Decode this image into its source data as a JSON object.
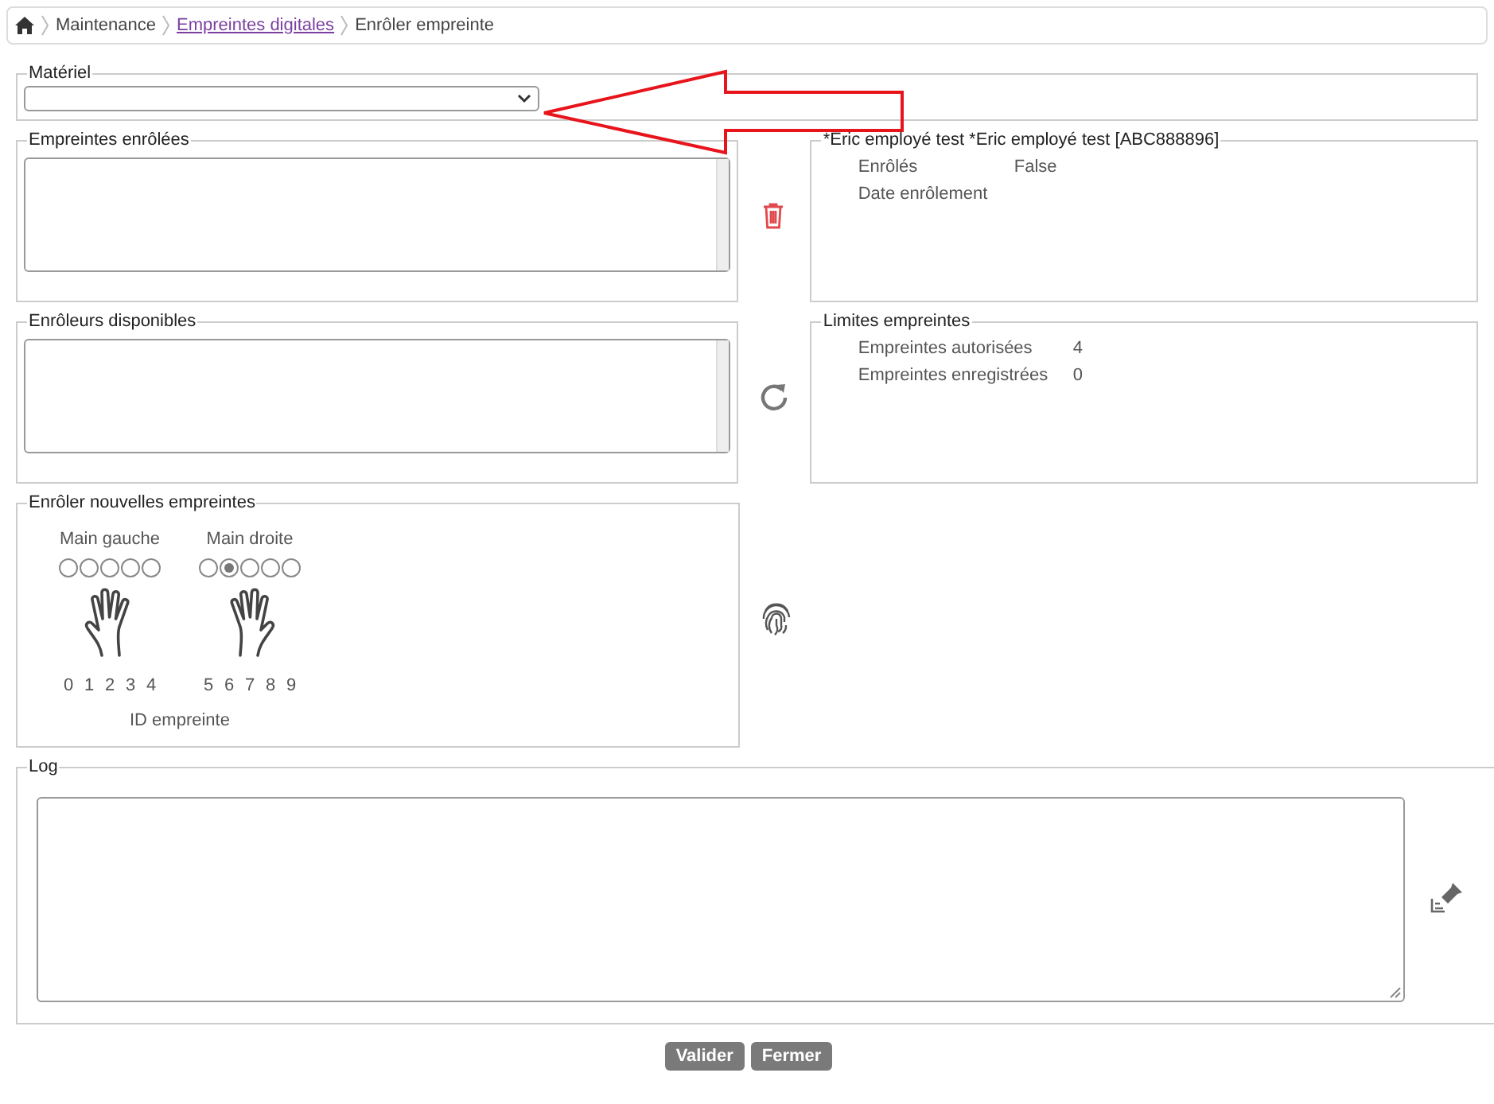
{
  "breadcrumb": [
    {
      "label": "Maintenance",
      "kind": "plain"
    },
    {
      "label": "Empreintes digitales",
      "kind": "link"
    },
    {
      "label": "Enrôler empreinte",
      "kind": "plain"
    }
  ],
  "materiel": {
    "legend": "Matériel"
  },
  "enrolled": {
    "legend": "Empreintes enrôlées"
  },
  "employee": {
    "legend": "*Eric employé test *Eric employé test [ABC888896]",
    "fields": [
      {
        "label": "Enrôlés",
        "value": "False"
      },
      {
        "label": "Date enrôlement"
      }
    ]
  },
  "enrollers": {
    "legend": "Enrôleurs disponibles"
  },
  "limits": {
    "legend": "Limites empreintes",
    "fields": [
      {
        "label": "Empreintes autorisées",
        "value": "4"
      },
      {
        "label": "Empreintes enregistrées",
        "value": "0"
      }
    ]
  },
  "new_prints": {
    "legend": "Enrôler nouvelles empreintes",
    "id_label": "ID empreinte",
    "hands": [
      {
        "label": "Main gauche",
        "fingers": [
          {
            "id": "0",
            "selected": false
          },
          {
            "id": "1",
            "selected": false
          },
          {
            "id": "2",
            "selected": false
          },
          {
            "id": "3",
            "selected": false
          },
          {
            "id": "4",
            "selected": false
          }
        ]
      },
      {
        "label": "Main droite",
        "fingers": [
          {
            "id": "5",
            "selected": false
          },
          {
            "id": "6",
            "selected": true
          },
          {
            "id": "7",
            "selected": false
          },
          {
            "id": "8",
            "selected": false
          },
          {
            "id": "9",
            "selected": false
          }
        ]
      }
    ]
  },
  "log": {
    "legend": "Log"
  },
  "buttons": [
    "Valider",
    "Fermer"
  ]
}
